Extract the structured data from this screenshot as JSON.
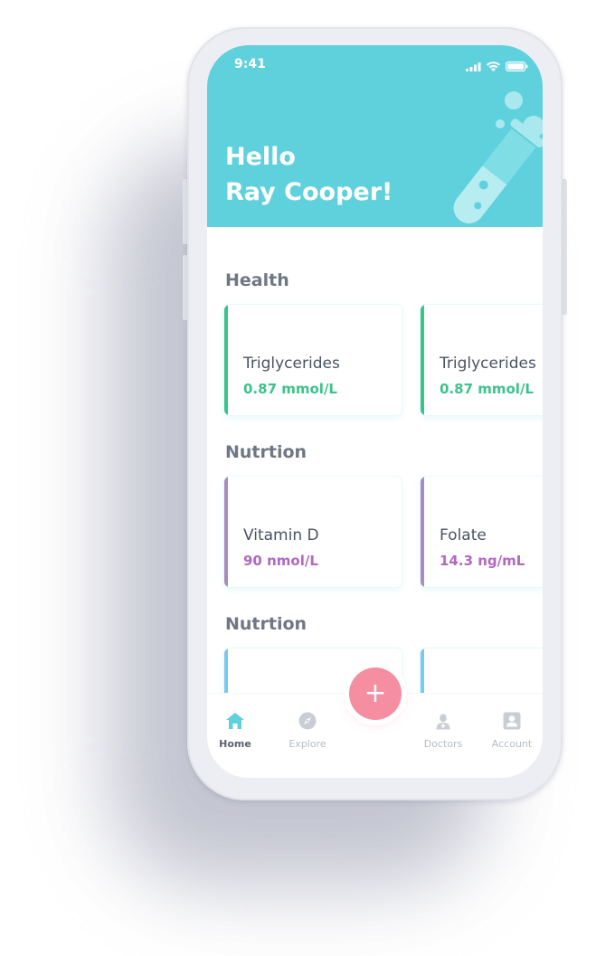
{
  "status": {
    "time": "9:41"
  },
  "header": {
    "greeting_line1": "Hello",
    "greeting_line2": "Ray Cooper!"
  },
  "sections": [
    {
      "title": "Health",
      "cards": [
        {
          "name": "Triglycerides",
          "value": "0.87 mmol/L"
        },
        {
          "name": "Triglycerides",
          "value": "0.87 mmol/L"
        }
      ]
    },
    {
      "title": "Nutrtion",
      "cards": [
        {
          "name": "Vitamin D",
          "value": "90 nmol/L"
        },
        {
          "name": "Folate",
          "value": "14.3 ng/mL"
        }
      ]
    },
    {
      "title": "Nutrtion",
      "cards": []
    }
  ],
  "fab": {
    "label": "+"
  },
  "tabs": [
    {
      "label": "Home",
      "icon": "home-icon",
      "active": true
    },
    {
      "label": "Explore",
      "icon": "compass-icon",
      "active": false
    },
    {
      "label": "Doctors",
      "icon": "doctor-icon",
      "active": false
    },
    {
      "label": "Account",
      "icon": "account-icon",
      "active": false
    }
  ],
  "colors": {
    "header": "#5fd1dd",
    "health_accent": "#3cc38c",
    "nutrition_accent": "#a88cbf",
    "nutrition_value": "#b268c2",
    "third_accent": "#78c8f0",
    "fab": "#f58ea0",
    "tab_active": "#5fd1dd",
    "tab_inactive": "#c9ced6"
  }
}
